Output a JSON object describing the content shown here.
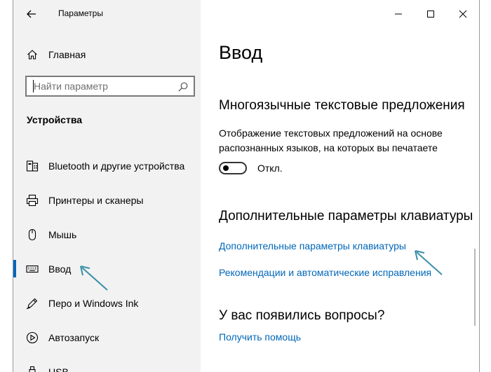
{
  "window": {
    "title": "Параметры",
    "back_icon": "back-arrow-icon",
    "controls": [
      "minimize-icon",
      "maximize-icon",
      "close-icon"
    ]
  },
  "sidebar": {
    "home_label": "Главная",
    "search": {
      "placeholder": "Найти параметр"
    },
    "section_heading": "Устройства",
    "items": [
      {
        "label": "Bluetooth и другие устройства",
        "icon": "bluetooth-devices-icon"
      },
      {
        "label": "Принтеры и сканеры",
        "icon": "printer-icon"
      },
      {
        "label": "Мышь",
        "icon": "mouse-icon"
      },
      {
        "label": "Ввод",
        "icon": "keyboard-icon",
        "selected": true
      },
      {
        "label": "Перо и Windows Ink",
        "icon": "pen-icon"
      },
      {
        "label": "Автозапуск",
        "icon": "autoplay-icon"
      },
      {
        "label": "USB",
        "icon": "usb-icon"
      }
    ]
  },
  "main": {
    "page_title": "Ввод",
    "multilingual": {
      "heading": "Многоязычные текстовые предложения",
      "description": "Отображение текстовых предложений на основе распознанных языков, на которых вы печатаете",
      "toggle_state": "Откл."
    },
    "keyboard": {
      "heading": "Дополнительные параметры клавиатуры",
      "link_advanced": "Дополнительные параметры клавиатуры",
      "link_recommendations": "Рекомендации и автоматические исправления"
    },
    "questions": {
      "heading": "У вас появились вопросы?",
      "link_help": "Получить помощь"
    }
  },
  "colors": {
    "accent": "#0067b8",
    "sidebar_bg": "#f2f2f2",
    "annotation_arrow": "#3a8fa8"
  }
}
